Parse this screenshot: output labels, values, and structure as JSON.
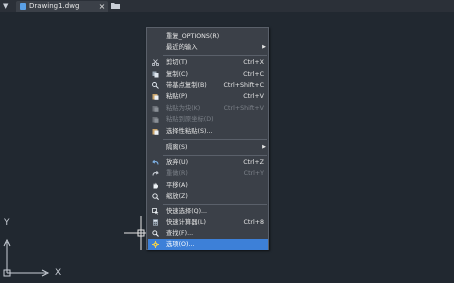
{
  "tabbar": {
    "menu_arrow": "▼",
    "tab_label": "Drawing1.dwg",
    "close_glyph": "×"
  },
  "ucs": {
    "x_label": "X",
    "y_label": "Y"
  },
  "menu": {
    "items": [
      {
        "label": "重复_OPTIONS(R)",
        "shortcut": "",
        "icon": "",
        "disabled": false
      },
      {
        "label": "最近的输入",
        "shortcut": "",
        "icon": "",
        "disabled": false,
        "submenu": true
      },
      {
        "label": "剪切(T)",
        "shortcut": "Ctrl+X",
        "icon": "scissors-icon",
        "disabled": false
      },
      {
        "label": "复制(C)",
        "shortcut": "Ctrl+C",
        "icon": "copy-icon",
        "disabled": false
      },
      {
        "label": "带基点复制(B)",
        "shortcut": "Ctrl+Shift+C",
        "icon": "copy-base-icon",
        "disabled": false
      },
      {
        "label": "粘贴(P)",
        "shortcut": "Ctrl+V",
        "icon": "paste-icon",
        "disabled": false
      },
      {
        "label": "粘贴为块(K)",
        "shortcut": "Ctrl+Shift+V",
        "icon": "paste-block-icon",
        "disabled": true
      },
      {
        "label": "粘贴到原坐标(D)",
        "shortcut": "",
        "icon": "paste-orig-icon",
        "disabled": true
      },
      {
        "label": "选择性粘贴(S)...",
        "shortcut": "",
        "icon": "paste-special-icon",
        "disabled": false
      },
      {
        "label": "隔离(S)",
        "shortcut": "",
        "icon": "",
        "disabled": false,
        "submenu": true
      },
      {
        "label": "放弃(U)",
        "shortcut": "Ctrl+Z",
        "icon": "undo-icon",
        "disabled": false
      },
      {
        "label": "重做(R)",
        "shortcut": "Ctrl+Y",
        "icon": "redo-icon",
        "disabled": true
      },
      {
        "label": "平移(A)",
        "shortcut": "",
        "icon": "pan-icon",
        "disabled": false
      },
      {
        "label": "缩放(Z)",
        "shortcut": "",
        "icon": "zoom-icon",
        "disabled": false
      },
      {
        "label": "快速选择(Q)...",
        "shortcut": "",
        "icon": "quick-select-icon",
        "disabled": false
      },
      {
        "label": "快速计算器(L)",
        "shortcut": "Ctrl+8",
        "icon": "calculator-icon",
        "disabled": false
      },
      {
        "label": "查找(F)...",
        "shortcut": "",
        "icon": "find-icon",
        "disabled": false
      },
      {
        "label": "选项(O)...",
        "shortcut": "",
        "icon": "options-icon",
        "disabled": false,
        "highlight": true
      }
    ],
    "submenu_arrow": "▶"
  },
  "colors": {
    "canvas": "#212830",
    "menu_bg": "#3b4048",
    "highlight": "#3d80d8",
    "text": "#e6e6e6",
    "disabled_text": "#7b8088"
  }
}
